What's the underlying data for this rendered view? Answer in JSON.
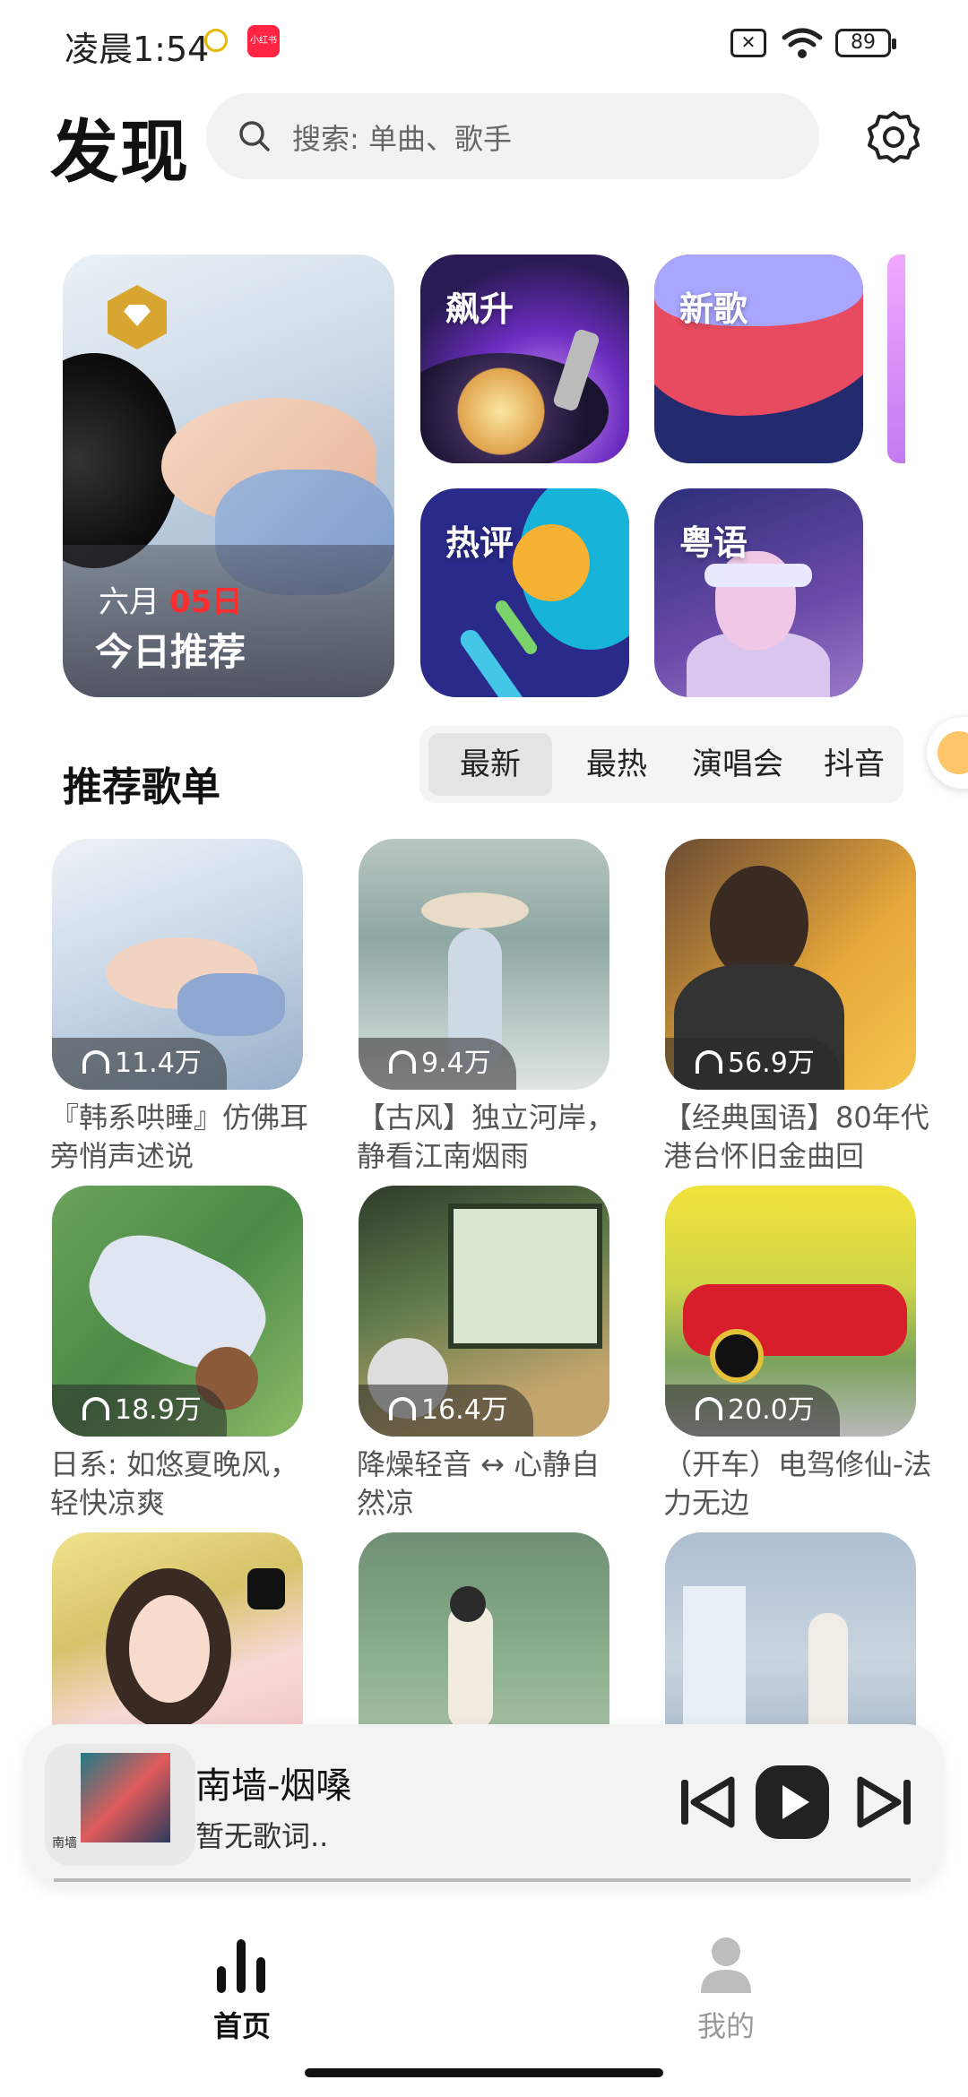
{
  "status_bar": {
    "time": "凌晨1:54",
    "app_badge": "小红书",
    "battery": "89"
  },
  "header": {
    "title": "发现",
    "search_placeholder": "搜索: 单曲、歌手"
  },
  "features": {
    "daily": {
      "month": "六月",
      "day": "05日",
      "label": "今日推荐"
    },
    "tiles": [
      "飙升",
      "新歌",
      "热评",
      "粤语"
    ]
  },
  "section": {
    "title": "推荐歌单",
    "tabs": [
      "最新",
      "最热",
      "演唱会",
      "抖音"
    ],
    "active_tab": "最新"
  },
  "playlists": [
    {
      "plays": "11.4万",
      "title": "『韩系哄睡』仿佛耳旁悄声述说"
    },
    {
      "plays": "9.4万",
      "title": "【古风】独立河岸，静看江南烟雨"
    },
    {
      "plays": "56.9万",
      "title": "【经典国语】80年代港台怀旧金曲回"
    },
    {
      "plays": "18.9万",
      "title": "日系: 如悠夏晚风，轻快凉爽"
    },
    {
      "plays": "16.4万",
      "title": "降燥轻音 ↔ 心静自然凉"
    },
    {
      "plays": "20.0万",
      "title": "（开车）电驾修仙-法力无边"
    },
    {
      "plays": "",
      "title": ""
    },
    {
      "plays": "",
      "title": ""
    },
    {
      "plays": "",
      "title": ""
    }
  ],
  "player": {
    "song": "南墙-烟嗓",
    "lyric": "暂无歌词..",
    "art_caption": "南墙"
  },
  "nav": {
    "home": "首页",
    "mine": "我的"
  },
  "colors": {
    "accent_date": "#ff2d2d",
    "badge_gold": "#d9a531"
  }
}
